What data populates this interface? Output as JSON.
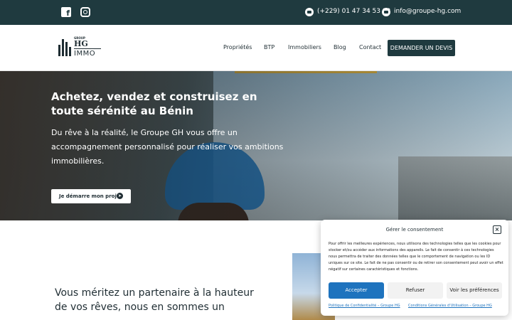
{
  "topbar": {
    "phone": "(+229) 01 47 34 53 92",
    "email": "info@groupe-hg.com",
    "icons": [
      "facebook-icon",
      "instagram-icon",
      "phone-icon",
      "mail-icon"
    ]
  },
  "logo": {
    "small": "GROUP",
    "hg": "HG",
    "immo": "IMMO"
  },
  "nav": {
    "items": [
      "Propriétés",
      "BTP",
      "Immobiliers",
      "Blog",
      "Contact"
    ],
    "cta": "DEMANDER UN DEVIS"
  },
  "hero": {
    "title": "Achetez, vendez et construisez en toute sérénité au Bénin",
    "subtitle": "Du rêve à la réalité, le Groupe GH vous offre un accompagnement personnalisé pour réaliser vos ambitions immobilières.",
    "button": "Je démarre mon projet"
  },
  "section": {
    "tagline": "Vous méritez un partenaire à la hauteur de vos rêves, nous en sommes un"
  },
  "consent": {
    "title": "Gérer le consentement",
    "body": "Pour offrir les meilleures expériences, nous utilisons des technologies telles que les cookies pour stocker et/ou accéder aux informations des appareils. Le fait de consentir à ces technologies nous permettra de traiter des données telles que le comportement de navigation ou les ID uniques sur ce site. Le fait de ne pas consentir ou de retirer son consentement peut avoir un effet négatif sur certaines caractéristiques et fonctions.",
    "accept": "Accepter",
    "refuse": "Refuser",
    "preferences": "Voir les préférences",
    "privacy_link": "Politique de Confidentialité – Groupe HG",
    "terms_link": "Conditions Générales d'Utilisation – Groupe HG"
  },
  "colors": {
    "dark_teal": "#1f3a3f",
    "accept_blue": "#1e73be"
  }
}
